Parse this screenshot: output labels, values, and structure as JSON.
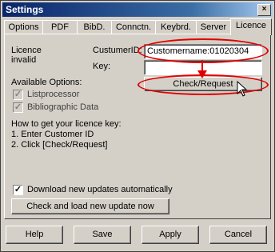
{
  "window": {
    "title": "Settings",
    "close_glyph": "×"
  },
  "tabs": [
    "Options",
    "PDF",
    "BibD.",
    "Connctn.",
    "Keybrd.",
    "Server",
    "Licence"
  ],
  "licence": {
    "status_line1": "Licence",
    "status_line2": "invalid",
    "customer_id_label": "CustumerID:",
    "customer_id_value": "Customername:01020304",
    "key_label": "Key:",
    "key_value": "",
    "check_button": "Check/Request"
  },
  "options": {
    "heading": "Available Options:",
    "items": [
      {
        "label": "Listprocessor",
        "checked": true
      },
      {
        "label": "Bibliographic Data",
        "checked": true
      }
    ]
  },
  "instructions": {
    "heading": "How to get your licence key:",
    "step1": "1. Enter Customer ID",
    "step2": "2. Click [Check/Request]"
  },
  "updates": {
    "auto_label": "Download new updates automatically",
    "auto_checked": true,
    "check_button": "Check and load new update now"
  },
  "footer": {
    "help": "Help",
    "save": "Save",
    "apply": "Apply",
    "cancel": "Cancel"
  },
  "colors": {
    "annotation": "#e00000",
    "title_bar": "#0a246a",
    "face": "#d4d0c8"
  }
}
